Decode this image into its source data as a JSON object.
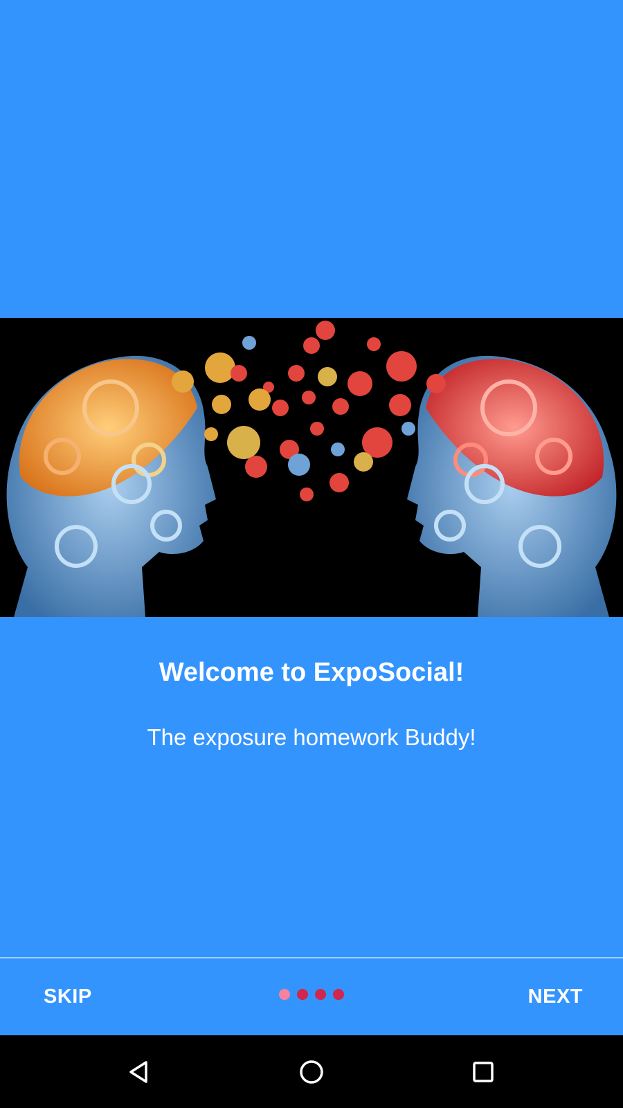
{
  "hero_image": {
    "description_icon": "gears-heads-illustration-icon"
  },
  "welcome": {
    "title": "Welcome to ExpoSocial!",
    "subtitle": "The exposure homework Buddy!"
  },
  "footer": {
    "skip_label": "SKIP",
    "next_label": "NEXT",
    "page_indicator": {
      "total": 4,
      "current": 1
    }
  },
  "colors": {
    "background": "#3494fd",
    "dot_active": "#f6829f",
    "dot_inactive": "#d1264e"
  },
  "system_nav": {
    "back_icon": "back-triangle-icon",
    "home_icon": "home-circle-icon",
    "recents_icon": "recents-square-icon"
  }
}
